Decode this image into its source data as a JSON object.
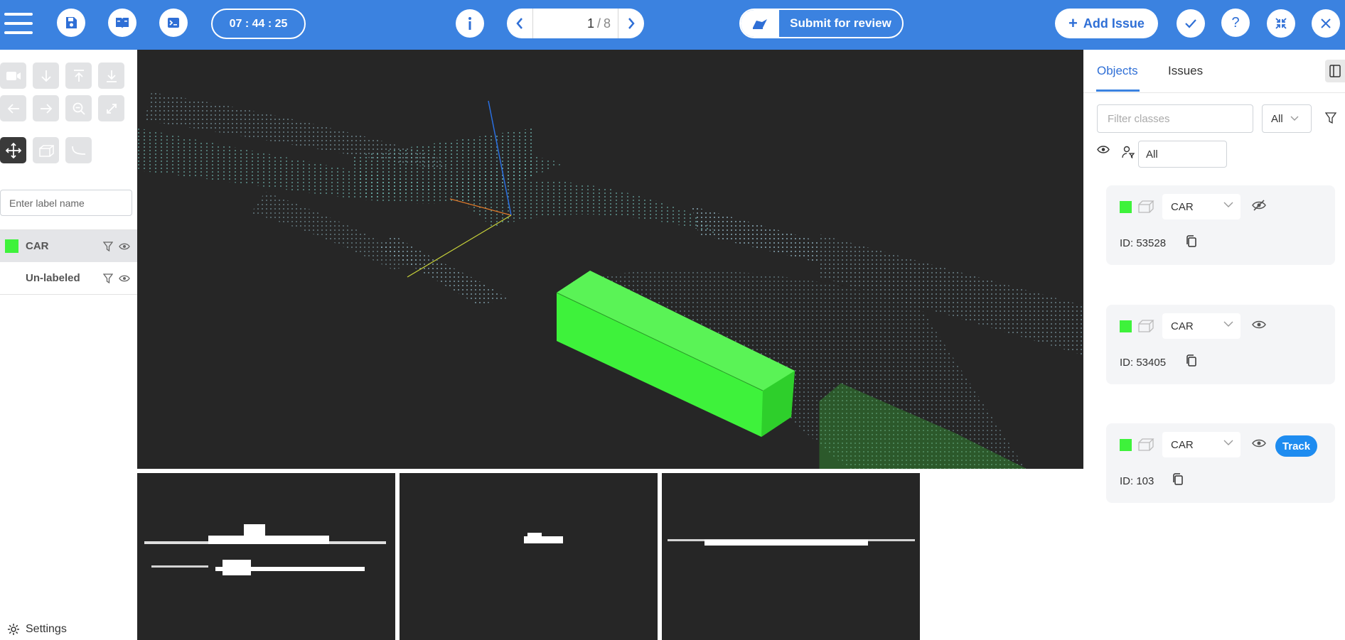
{
  "topbar": {
    "timer": "07 : 44 : 25",
    "page_current": "1",
    "page_total": "8",
    "page_sep": "/",
    "submit_label": "Submit for review",
    "add_issue_label": "Add Issue",
    "accent_color": "#3b82e0"
  },
  "left_panel": {
    "label_placeholder": "Enter label name",
    "labels": [
      {
        "name": "CAR",
        "color": "#3ef23b",
        "selected": true
      },
      {
        "name": "Un-labeled",
        "color": null,
        "selected": false
      }
    ],
    "settings_label": "Settings"
  },
  "right_panel": {
    "tabs": [
      {
        "label": "Objects",
        "active": true
      },
      {
        "label": "Issues",
        "active": false
      }
    ],
    "filter_placeholder": "Filter classes",
    "class_filter_value": "All",
    "user_filter_value": "All",
    "objects": [
      {
        "class": "CAR",
        "id_text": "ID: 53528",
        "visible": false,
        "track_label": null
      },
      {
        "class": "CAR",
        "id_text": "ID: 53405",
        "visible": true,
        "track_label": null
      },
      {
        "class": "CAR",
        "id_text": "ID: 103",
        "visible": true,
        "track_label": "Track"
      }
    ]
  }
}
